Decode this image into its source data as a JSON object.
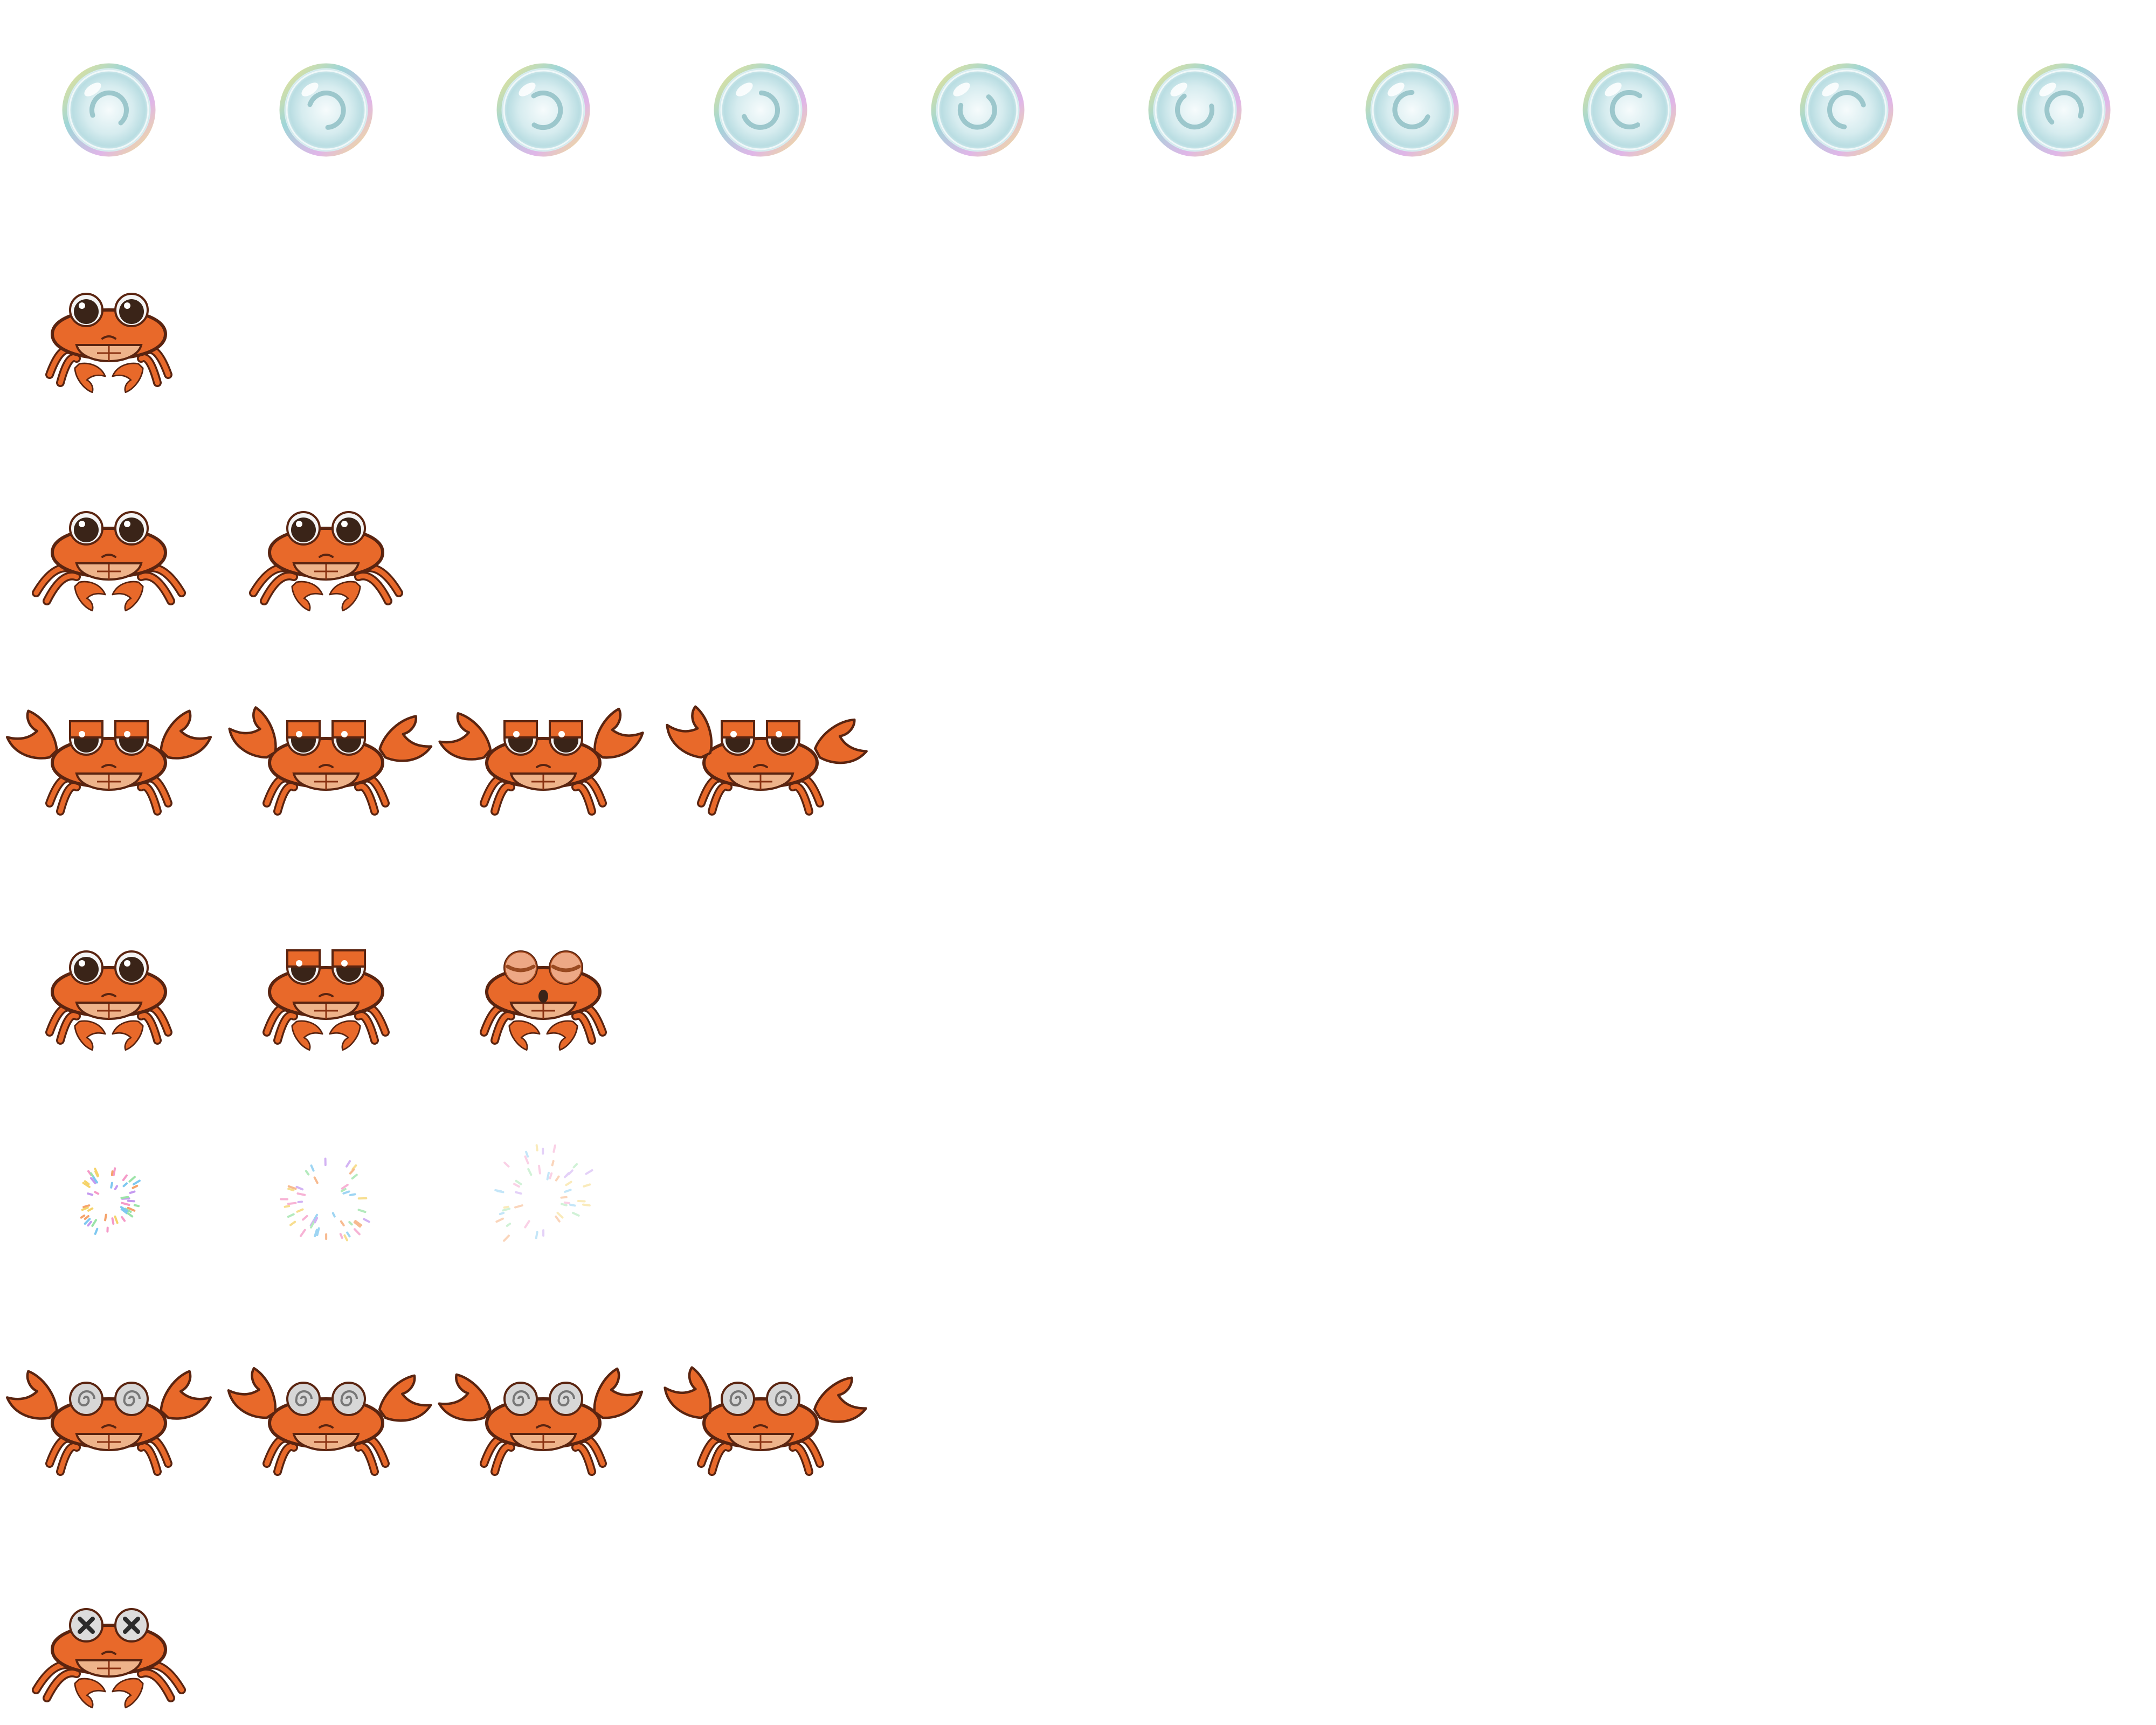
{
  "sprite_sheet": {
    "background": "#ffffff",
    "rows": [
      {
        "animation": "bubble",
        "frame_count": 10,
        "frames": [
          "bubble-frame-1",
          "bubble-frame-2",
          "bubble-frame-3",
          "bubble-frame-4",
          "bubble-frame-5",
          "bubble-frame-6",
          "bubble-frame-7",
          "bubble-frame-8",
          "bubble-frame-9",
          "bubble-frame-10"
        ]
      },
      {
        "animation": "idle",
        "frame_count": 1,
        "frames": [
          "crab-idle"
        ]
      },
      {
        "animation": "walk",
        "frame_count": 2,
        "frames": [
          "crab-walk-1",
          "crab-walk-2"
        ]
      },
      {
        "animation": "angry",
        "frame_count": 4,
        "frames": [
          "crab-angry-1",
          "crab-angry-2",
          "crab-angry-3",
          "crab-angry-4"
        ]
      },
      {
        "animation": "blink",
        "frame_count": 3,
        "frames": [
          "crab-blink-open",
          "crab-blink-half",
          "crab-blink-closed"
        ]
      },
      {
        "animation": "sparkle",
        "frame_count": 3,
        "frames": [
          "sparkle-1",
          "sparkle-2",
          "sparkle-3"
        ]
      },
      {
        "animation": "dizzy",
        "frame_count": 4,
        "frames": [
          "crab-dizzy-1",
          "crab-dizzy-2",
          "crab-dizzy-3",
          "crab-dizzy-4"
        ]
      },
      {
        "animation": "dead",
        "frame_count": 1,
        "frames": [
          "crab-dead"
        ]
      }
    ]
  },
  "colors": {
    "shell": "#e8692a",
    "shell_dark": "#8a3212",
    "belly": "#eeb38a",
    "outline": "#5a2410",
    "eye_white": "#f4f4f4",
    "pupil": "#3a2418",
    "bubble_core": "#cfe6ea",
    "bubble_rim_1": "#f2e58a",
    "bubble_rim_2": "#9fd6d8",
    "bubble_rim_3": "#e0b6e8",
    "dizzy_eye": "#d7d7d7",
    "dizzy_swirl": "#777777",
    "dead_eye": "#dcdcdc",
    "dead_x": "#2b2b2b",
    "sparkle_palette": [
      "#f59ac8",
      "#7ec8f0",
      "#f5d36b",
      "#9be3a8",
      "#c59af0",
      "#f5a36b"
    ]
  }
}
